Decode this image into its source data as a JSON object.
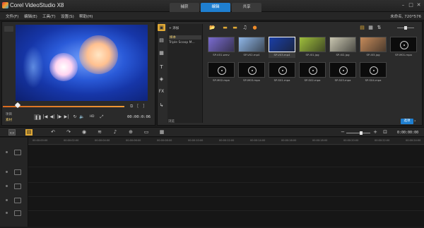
{
  "window": {
    "title": "Corel VideoStudio X8",
    "tabs": [
      "捕获",
      "编辑",
      "共享"
    ],
    "active_tab": "编辑",
    "controls": {
      "minimize": "–",
      "maximize": "□",
      "close": "✕"
    }
  },
  "menu": {
    "items": [
      "文件(F)",
      "编辑(E)",
      "工具(T)",
      "设置(S)",
      "帮助(H)"
    ],
    "project_info": "未命名, 720*576"
  },
  "player": {
    "modes": [
      "项目",
      "素材"
    ],
    "timecode": "00:00:0:06",
    "transport": {
      "play": "❚❚",
      "home": "|◀",
      "prev": "◀|",
      "next": "|▶",
      "end": "▶|",
      "repeat": "↻",
      "volume": "🔈",
      "hd": "HD",
      "fullscreen": "⤢"
    }
  },
  "library": {
    "add_label": "+ 添加",
    "folders": [
      "样本",
      "Triple Scoop M..."
    ],
    "footer": "浏览",
    "options_label": "选项",
    "items": [
      {
        "caption": "SP-V01.wmv",
        "kind": "video",
        "color": "#7a6bd1"
      },
      {
        "caption": "SP-V02.mp4",
        "kind": "video",
        "color": "#8fb7e8"
      },
      {
        "caption": "SP-V03.mp4",
        "kind": "video",
        "color": "#1a3fa8",
        "selected": true
      },
      {
        "caption": "SP-I01.jpg",
        "kind": "image",
        "color": "#9fbf3c"
      },
      {
        "caption": "SP-I02.jpg",
        "kind": "image",
        "color": "#c9c6b0"
      },
      {
        "caption": "SP-I03.jpg",
        "kind": "image",
        "color": "#c58a5a"
      },
      {
        "caption": "SP-M01.mpa",
        "kind": "audio"
      },
      {
        "caption": "SP-M02.mpa",
        "kind": "audio"
      },
      {
        "caption": "SP-M03.mpa",
        "kind": "audio"
      },
      {
        "caption": "SP-S01.mpa",
        "kind": "audio"
      },
      {
        "caption": "SP-S02.mpa",
        "kind": "audio"
      },
      {
        "caption": "SP-S03.mpa",
        "kind": "audio"
      },
      {
        "caption": "SP-S04.mpa",
        "kind": "audio"
      }
    ]
  },
  "timeline": {
    "timecode": "0:00:00:00",
    "ruler": [
      "00:00:00:00",
      "00:00:02:00",
      "00:00:04:00",
      "00:00:06:00",
      "00:00:08:00",
      "00:00:10:00",
      "00:00:12:00",
      "00:00:14:00",
      "00:00:16:00",
      "00:00:18:00",
      "00:00:20:00",
      "00:00:22:00",
      "00:00:24:00"
    ]
  }
}
